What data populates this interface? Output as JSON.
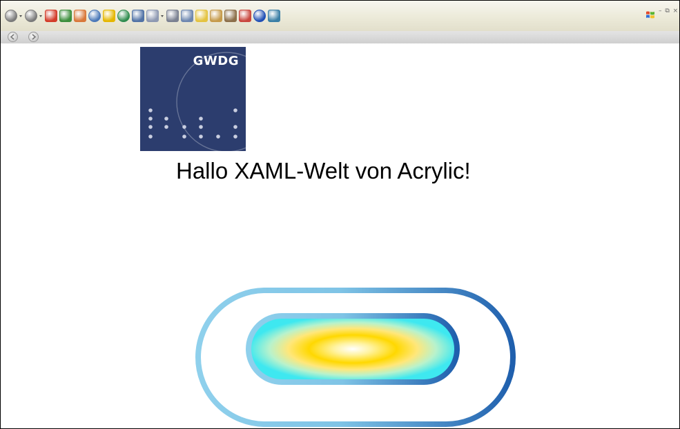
{
  "toolbar": {
    "icons": [
      {
        "name": "back-icon",
        "color": "#7a7a7a",
        "shape": "round",
        "dropdown": true
      },
      {
        "name": "forward-icon",
        "color": "#7a7a7a",
        "shape": "round",
        "dropdown": true
      },
      {
        "name": "stop-icon",
        "color": "#d33c2a",
        "shape": "square"
      },
      {
        "name": "refresh-icon",
        "color": "#3d8f3d",
        "shape": "square"
      },
      {
        "name": "home-icon",
        "color": "#d9783a",
        "shape": "square"
      },
      {
        "name": "search-icon",
        "color": "#4a78b8",
        "shape": "round"
      },
      {
        "name": "favorites-star-icon",
        "color": "#e5b700",
        "shape": "square"
      },
      {
        "name": "history-icon",
        "color": "#2f8c4e",
        "shape": "round"
      },
      {
        "name": "view-icon",
        "color": "#5273a6",
        "shape": "square"
      },
      {
        "name": "mail-icon",
        "color": "#8e99b2",
        "shape": "square",
        "dropdown": true
      },
      {
        "name": "print-icon",
        "color": "#7b8191",
        "shape": "square"
      },
      {
        "name": "edit-icon",
        "color": "#6f88b0",
        "shape": "square"
      },
      {
        "name": "notes-icon",
        "color": "#e4c340",
        "shape": "square"
      },
      {
        "name": "research-icon",
        "color": "#c69b4b",
        "shape": "square"
      },
      {
        "name": "messenger-icon",
        "color": "#8c6f4a",
        "shape": "square"
      },
      {
        "name": "pdf-icon",
        "color": "#c9473f",
        "shape": "square"
      },
      {
        "name": "bluetooth-icon",
        "color": "#1f4fb5",
        "shape": "round"
      },
      {
        "name": "connect-icon",
        "color": "#3b7fa6",
        "shape": "square"
      }
    ],
    "window_controls": "– ⧉ ×"
  },
  "logo": {
    "text": "GWDG",
    "background": "#2c3d6e"
  },
  "heading": "Hallo XAML-Welt von Acrylic!",
  "colors": {
    "outer_border_light": "#8fd0ec",
    "outer_border_dark": "#1f5fad",
    "inner_center": "#ffffff",
    "inner_yellow": "#ffd800",
    "inner_cyan": "#3ee8f0"
  }
}
